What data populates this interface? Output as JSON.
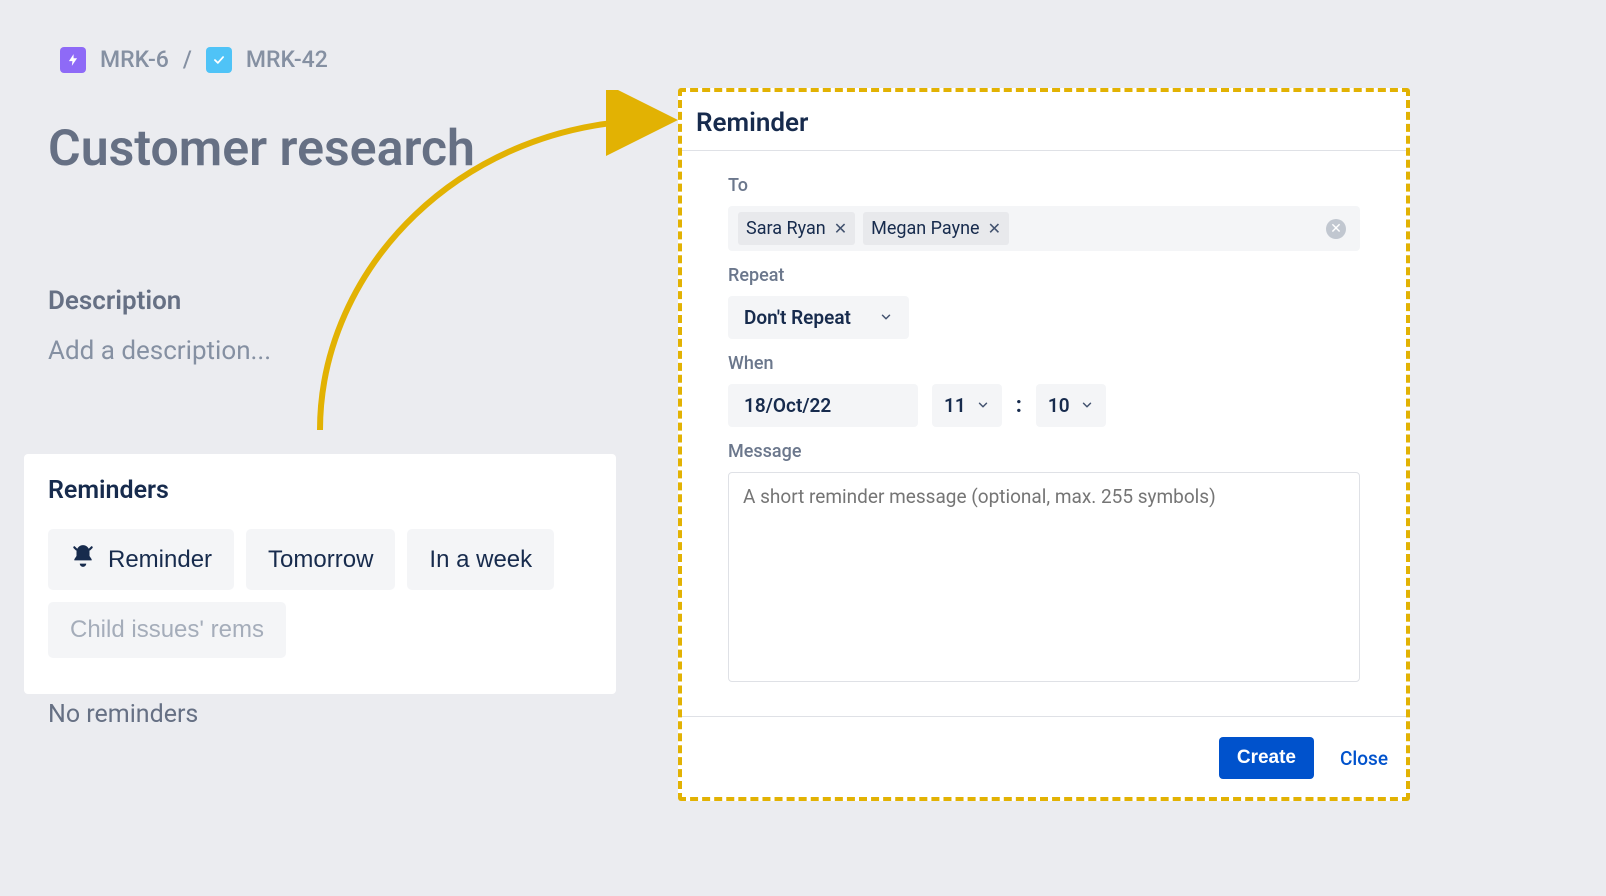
{
  "breadcrumb": {
    "parent_key": "MRK-6",
    "child_key": "MRK-42",
    "separator": "/"
  },
  "page": {
    "title": "Customer research"
  },
  "description": {
    "label": "Description",
    "placeholder": "Add a description..."
  },
  "reminders_panel": {
    "title": "Reminders",
    "buttons": {
      "reminder": "Reminder",
      "tomorrow": "Tomorrow",
      "in_a_week": "In a week",
      "child_issues": "Child issues' rems"
    },
    "empty_text": "No reminders"
  },
  "modal": {
    "title": "Reminder",
    "to": {
      "label": "To",
      "recipients": [
        "Sara Ryan",
        "Megan Payne"
      ]
    },
    "repeat": {
      "label": "Repeat",
      "value": "Don't Repeat"
    },
    "when": {
      "label": "When",
      "date": "18/Oct/22",
      "hour": "11",
      "minute": "10"
    },
    "message": {
      "label": "Message",
      "placeholder": "A short reminder message (optional, max. 255 symbols)"
    },
    "actions": {
      "create": "Create",
      "close": "Close"
    }
  },
  "colors": {
    "accent_blue": "#0052cc",
    "highlight_yellow": "#e2b203"
  }
}
